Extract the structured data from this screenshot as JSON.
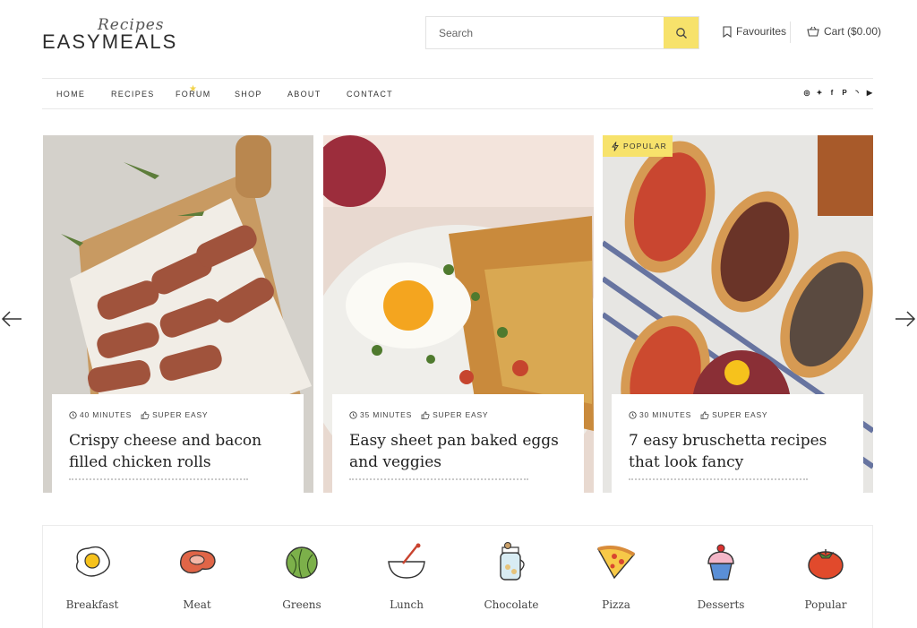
{
  "header": {
    "logo_script": "Recipes",
    "logo_main": "EASYMEALS",
    "search_placeholder": "Search",
    "favourites_label": "Favourites",
    "cart_label": "Cart ($0.00)"
  },
  "nav": {
    "items": [
      "HOME",
      "RECIPES",
      "FORUM",
      "SHOP",
      "ABOUT",
      "CONTACT"
    ],
    "social_icons": [
      "instagram-icon",
      "twitter-icon",
      "facebook-icon",
      "pinterest-icon",
      "rss-icon",
      "youtube-icon"
    ]
  },
  "cards": [
    {
      "time": "40 MINUTES",
      "difficulty": "SUPER EASY",
      "title": "Crispy cheese and bacon filled chicken rolls",
      "badge": ""
    },
    {
      "time": "35 MINUTES",
      "difficulty": "SUPER EASY",
      "title": "Easy sheet pan baked eggs and veggies",
      "badge": ""
    },
    {
      "time": "30 MINUTES",
      "difficulty": "SUPER EASY",
      "title": "7 easy bruschetta recipes that look fancy",
      "badge": "POPULAR"
    }
  ],
  "categories": [
    "Breakfast",
    "Meat",
    "Greens",
    "Lunch",
    "Chocolate",
    "Pizza",
    "Desserts",
    "Popular"
  ],
  "colors": {
    "accent": "#f7e26b",
    "text": "#222222"
  }
}
